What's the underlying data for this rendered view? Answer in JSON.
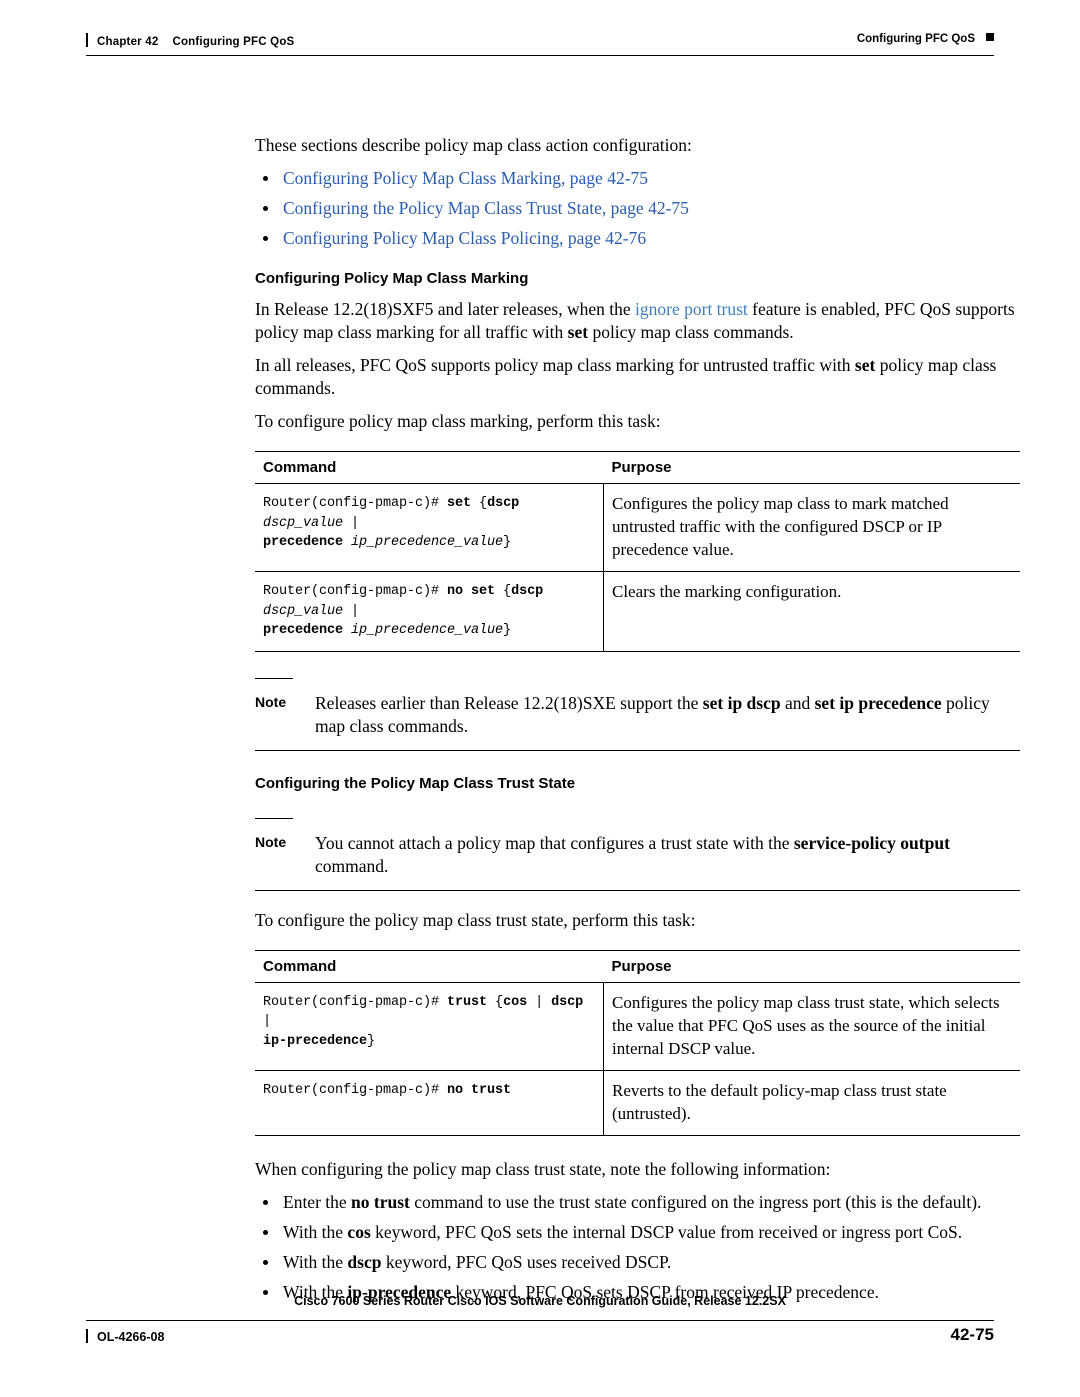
{
  "header": {
    "chapter": "Chapter 42",
    "chapter_title": "Configuring PFC QoS",
    "running_head": "Configuring PFC QoS"
  },
  "intro": {
    "lead": "These sections describe policy map class action configuration:",
    "links": [
      "Configuring Policy Map Class Marking, page 42-75",
      "Configuring the Policy Map Class Trust State, page 42-75",
      "Configuring Policy Map Class Policing, page 42-76"
    ]
  },
  "marking": {
    "heading": "Configuring Policy Map Class Marking",
    "para1_a": "In Release 12.2(18)SXF5 and later releases, when the ",
    "para1_link": "ignore port trust",
    "para1_b": " feature is enabled, PFC QoS supports policy map class marking for all traffic with ",
    "para1_bold": "set",
    "para1_c": " policy map class commands.",
    "para2_a": "In all releases, PFC QoS supports policy map class marking for untrusted traffic with ",
    "para2_bold": "set",
    "para2_b": " policy map class commands.",
    "para3": "To configure policy map class marking, perform this task:"
  },
  "table1": {
    "col1_header": "Command",
    "col2_header": "Purpose",
    "rows": [
      {
        "cmd_prompt": "Router(config-pmap-c)# ",
        "cmd_bold1": "set",
        "cmd_plain1": " {",
        "cmd_bold2": "dscp",
        "cmd_italic1": " dscp_value",
        "cmd_plain2": " | ",
        "cmd_bold3": "precedence",
        "cmd_italic2": " ip_precedence_value",
        "cmd_plain3": "}",
        "purpose": "Configures the policy map class to mark matched untrusted traffic with the configured DSCP or IP precedence value."
      },
      {
        "cmd_prompt": "Router(config-pmap-c)# ",
        "cmd_bold1": "no set",
        "cmd_plain1": " {",
        "cmd_bold2": "dscp",
        "cmd_italic1": " dscp_value",
        "cmd_plain2": " | ",
        "cmd_bold3": "precedence",
        "cmd_italic2": " ip_precedence_value",
        "cmd_plain3": "}",
        "purpose": "Clears the marking configuration."
      }
    ]
  },
  "note1": {
    "label": "Note",
    "text_a": "Releases earlier than Release 12.2(18)SXE support the ",
    "bold1": "set ip dscp",
    "text_b": " and ",
    "bold2": "set ip precedence",
    "text_c": " policy map class commands."
  },
  "trust": {
    "heading": "Configuring the Policy Map Class Trust State",
    "note_label": "Note",
    "note_a": "You cannot attach a policy map that configures a trust state with the ",
    "note_bold": "service-policy output",
    "note_b": " command.",
    "para": "To configure the policy map class trust state, perform this task:"
  },
  "table2": {
    "col1_header": "Command",
    "col2_header": "Purpose",
    "rows": [
      {
        "cmd_prompt": "Router(config-pmap-c)# ",
        "cmd_bold1": "trust",
        "cmd_plain1": " {",
        "cmd_bold2": "cos",
        "cmd_plain2": " | ",
        "cmd_bold3": "dscp",
        "cmd_plain3": " | ",
        "cmd_bold4": "ip-precedence",
        "cmd_plain4": "}",
        "purpose": "Configures the policy map class trust state, which selects the value that PFC QoS uses as the source of the initial internal DSCP value."
      },
      {
        "cmd_prompt": "Router(config-pmap-c)# ",
        "cmd_bold1": "no trust",
        "purpose": "Reverts to the default policy-map class trust state (untrusted)."
      }
    ]
  },
  "outro": {
    "lead": "When configuring the policy map class trust state, note the following information:",
    "bullets": [
      {
        "a": "Enter the ",
        "bold": "no trust",
        "b": " command to use the trust state configured on the ingress port (this is the default)."
      },
      {
        "a": "With the ",
        "bold": "cos",
        "b": " keyword, PFC QoS sets the internal DSCP value from received or ingress port CoS."
      },
      {
        "a": "With the ",
        "bold": "dscp",
        "b": " keyword, PFC QoS uses received DSCP."
      },
      {
        "a": "With the ",
        "bold": "ip-precedence",
        "b": " keyword, PFC QoS sets DSCP from received IP precedence."
      }
    ]
  },
  "footer": {
    "center": "Cisco 7600 Series Router Cisco IOS Software Configuration Guide, Release 12.2SX",
    "doc_id": "OL-4266-08",
    "page_number": "42-75"
  }
}
